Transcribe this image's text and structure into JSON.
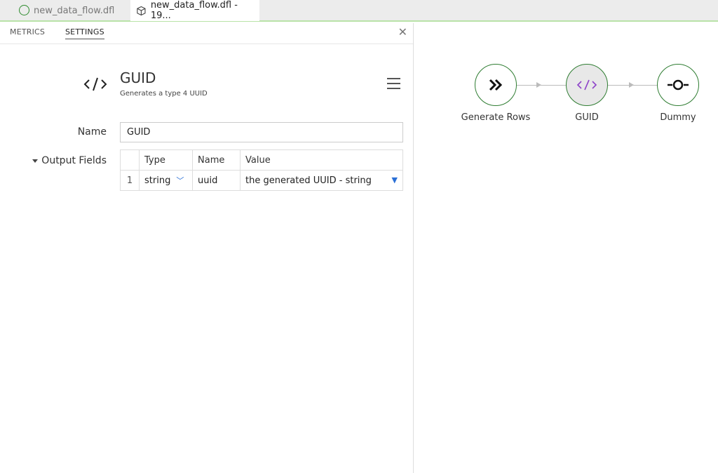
{
  "tabs": [
    {
      "label": "new_data_flow.dfl",
      "icon": "circle-icon"
    },
    {
      "label": "new_data_flow.dfl - 19...",
      "icon": "cube-icon"
    }
  ],
  "subtabs": [
    "METRICS",
    "SETTINGS"
  ],
  "step": {
    "title": "GUID",
    "subtitle": "Generates a type 4 UUID",
    "icon": "code-icon"
  },
  "form": {
    "name_label": "Name",
    "name_value": "GUID",
    "output_fields_label": "Output Fields",
    "columns": [
      "Type",
      "Name",
      "Value"
    ],
    "rows": [
      {
        "num": "1",
        "type": "string",
        "name": "uuid",
        "value": "the generated UUID - string"
      }
    ]
  },
  "flow": {
    "nodes": [
      {
        "label": "Generate Rows",
        "icon": "double-chevron-icon"
      },
      {
        "label": "GUID",
        "icon": "code-icon",
        "selected": true
      },
      {
        "label": "Dummy",
        "icon": "dummy-icon"
      }
    ]
  },
  "colors": {
    "node_border": "#2f7d32",
    "accent_blue": "#2a6fd6",
    "code_purple": "#8e44c9"
  }
}
